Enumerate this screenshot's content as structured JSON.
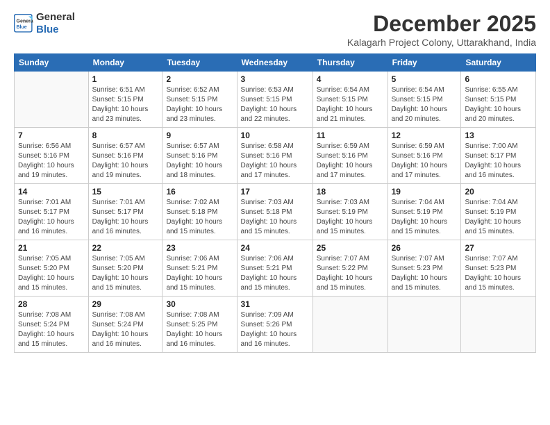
{
  "header": {
    "logo_line1": "General",
    "logo_line2": "Blue",
    "month_title": "December 2025",
    "subtitle": "Kalagarh Project Colony, Uttarakhand, India"
  },
  "weekdays": [
    "Sunday",
    "Monday",
    "Tuesday",
    "Wednesday",
    "Thursday",
    "Friday",
    "Saturday"
  ],
  "weeks": [
    [
      {
        "day": "",
        "info": ""
      },
      {
        "day": "1",
        "info": "Sunrise: 6:51 AM\nSunset: 5:15 PM\nDaylight: 10 hours\nand 23 minutes."
      },
      {
        "day": "2",
        "info": "Sunrise: 6:52 AM\nSunset: 5:15 PM\nDaylight: 10 hours\nand 23 minutes."
      },
      {
        "day": "3",
        "info": "Sunrise: 6:53 AM\nSunset: 5:15 PM\nDaylight: 10 hours\nand 22 minutes."
      },
      {
        "day": "4",
        "info": "Sunrise: 6:54 AM\nSunset: 5:15 PM\nDaylight: 10 hours\nand 21 minutes."
      },
      {
        "day": "5",
        "info": "Sunrise: 6:54 AM\nSunset: 5:15 PM\nDaylight: 10 hours\nand 20 minutes."
      },
      {
        "day": "6",
        "info": "Sunrise: 6:55 AM\nSunset: 5:15 PM\nDaylight: 10 hours\nand 20 minutes."
      }
    ],
    [
      {
        "day": "7",
        "info": "Sunrise: 6:56 AM\nSunset: 5:16 PM\nDaylight: 10 hours\nand 19 minutes."
      },
      {
        "day": "8",
        "info": "Sunrise: 6:57 AM\nSunset: 5:16 PM\nDaylight: 10 hours\nand 19 minutes."
      },
      {
        "day": "9",
        "info": "Sunrise: 6:57 AM\nSunset: 5:16 PM\nDaylight: 10 hours\nand 18 minutes."
      },
      {
        "day": "10",
        "info": "Sunrise: 6:58 AM\nSunset: 5:16 PM\nDaylight: 10 hours\nand 17 minutes."
      },
      {
        "day": "11",
        "info": "Sunrise: 6:59 AM\nSunset: 5:16 PM\nDaylight: 10 hours\nand 17 minutes."
      },
      {
        "day": "12",
        "info": "Sunrise: 6:59 AM\nSunset: 5:16 PM\nDaylight: 10 hours\nand 17 minutes."
      },
      {
        "day": "13",
        "info": "Sunrise: 7:00 AM\nSunset: 5:17 PM\nDaylight: 10 hours\nand 16 minutes."
      }
    ],
    [
      {
        "day": "14",
        "info": "Sunrise: 7:01 AM\nSunset: 5:17 PM\nDaylight: 10 hours\nand 16 minutes."
      },
      {
        "day": "15",
        "info": "Sunrise: 7:01 AM\nSunset: 5:17 PM\nDaylight: 10 hours\nand 16 minutes."
      },
      {
        "day": "16",
        "info": "Sunrise: 7:02 AM\nSunset: 5:18 PM\nDaylight: 10 hours\nand 15 minutes."
      },
      {
        "day": "17",
        "info": "Sunrise: 7:03 AM\nSunset: 5:18 PM\nDaylight: 10 hours\nand 15 minutes."
      },
      {
        "day": "18",
        "info": "Sunrise: 7:03 AM\nSunset: 5:19 PM\nDaylight: 10 hours\nand 15 minutes."
      },
      {
        "day": "19",
        "info": "Sunrise: 7:04 AM\nSunset: 5:19 PM\nDaylight: 10 hours\nand 15 minutes."
      },
      {
        "day": "20",
        "info": "Sunrise: 7:04 AM\nSunset: 5:19 PM\nDaylight: 10 hours\nand 15 minutes."
      }
    ],
    [
      {
        "day": "21",
        "info": "Sunrise: 7:05 AM\nSunset: 5:20 PM\nDaylight: 10 hours\nand 15 minutes."
      },
      {
        "day": "22",
        "info": "Sunrise: 7:05 AM\nSunset: 5:20 PM\nDaylight: 10 hours\nand 15 minutes."
      },
      {
        "day": "23",
        "info": "Sunrise: 7:06 AM\nSunset: 5:21 PM\nDaylight: 10 hours\nand 15 minutes."
      },
      {
        "day": "24",
        "info": "Sunrise: 7:06 AM\nSunset: 5:21 PM\nDaylight: 10 hours\nand 15 minutes."
      },
      {
        "day": "25",
        "info": "Sunrise: 7:07 AM\nSunset: 5:22 PM\nDaylight: 10 hours\nand 15 minutes."
      },
      {
        "day": "26",
        "info": "Sunrise: 7:07 AM\nSunset: 5:23 PM\nDaylight: 10 hours\nand 15 minutes."
      },
      {
        "day": "27",
        "info": "Sunrise: 7:07 AM\nSunset: 5:23 PM\nDaylight: 10 hours\nand 15 minutes."
      }
    ],
    [
      {
        "day": "28",
        "info": "Sunrise: 7:08 AM\nSunset: 5:24 PM\nDaylight: 10 hours\nand 15 minutes."
      },
      {
        "day": "29",
        "info": "Sunrise: 7:08 AM\nSunset: 5:24 PM\nDaylight: 10 hours\nand 16 minutes."
      },
      {
        "day": "30",
        "info": "Sunrise: 7:08 AM\nSunset: 5:25 PM\nDaylight: 10 hours\nand 16 minutes."
      },
      {
        "day": "31",
        "info": "Sunrise: 7:09 AM\nSunset: 5:26 PM\nDaylight: 10 hours\nand 16 minutes."
      },
      {
        "day": "",
        "info": ""
      },
      {
        "day": "",
        "info": ""
      },
      {
        "day": "",
        "info": ""
      }
    ]
  ]
}
